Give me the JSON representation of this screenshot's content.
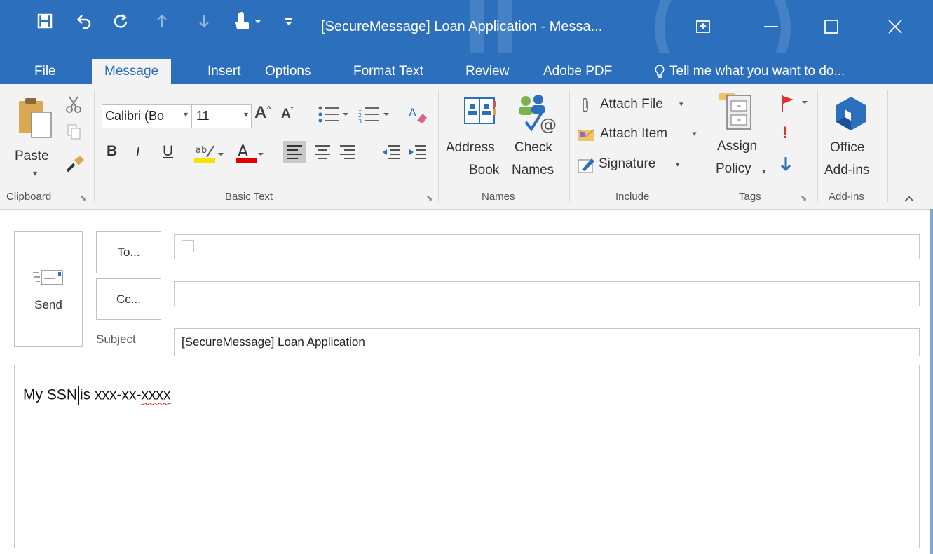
{
  "window": {
    "title": "[SecureMessage] Loan Application - Messa...",
    "accent": "#2b6fbd"
  },
  "tabs": [
    {
      "label": "File"
    },
    {
      "label": "Message"
    },
    {
      "label": "Insert"
    },
    {
      "label": "Options"
    },
    {
      "label": "Format Text"
    },
    {
      "label": "Review"
    },
    {
      "label": "Adobe PDF"
    }
  ],
  "tell_me": "Tell me what you want to do...",
  "ribbon": {
    "clipboard": {
      "paste": "Paste",
      "label": "Clipboard"
    },
    "basic_text": {
      "font_name": "Calibri (Bo",
      "font_size": "11",
      "bold": "B",
      "italic": "I",
      "underline": "U",
      "label": "Basic Text"
    },
    "names": {
      "address_book": [
        "Address",
        "Book"
      ],
      "check_names": [
        "Check",
        "Names"
      ],
      "label": "Names"
    },
    "include": {
      "attach_file": "Attach File",
      "attach_item": "Attach Item",
      "signature": "Signature",
      "label": "Include"
    },
    "tags": {
      "assign_policy": [
        "Assign",
        "Policy"
      ],
      "label": "Tags"
    },
    "addins": {
      "office_addins": [
        "Office",
        "Add-ins"
      ],
      "label": "Add-ins"
    }
  },
  "compose": {
    "send": "Send",
    "to_button": "To...",
    "cc_button": "Cc...",
    "subject_label": "Subject",
    "to_value": "",
    "cc_value": "",
    "subject_value": "[SecureMessage] Loan Application",
    "body_before_cursor": "My SSN",
    "body_after_cursor": "is xxx-xx-",
    "body_misspelled": "xxxx"
  }
}
